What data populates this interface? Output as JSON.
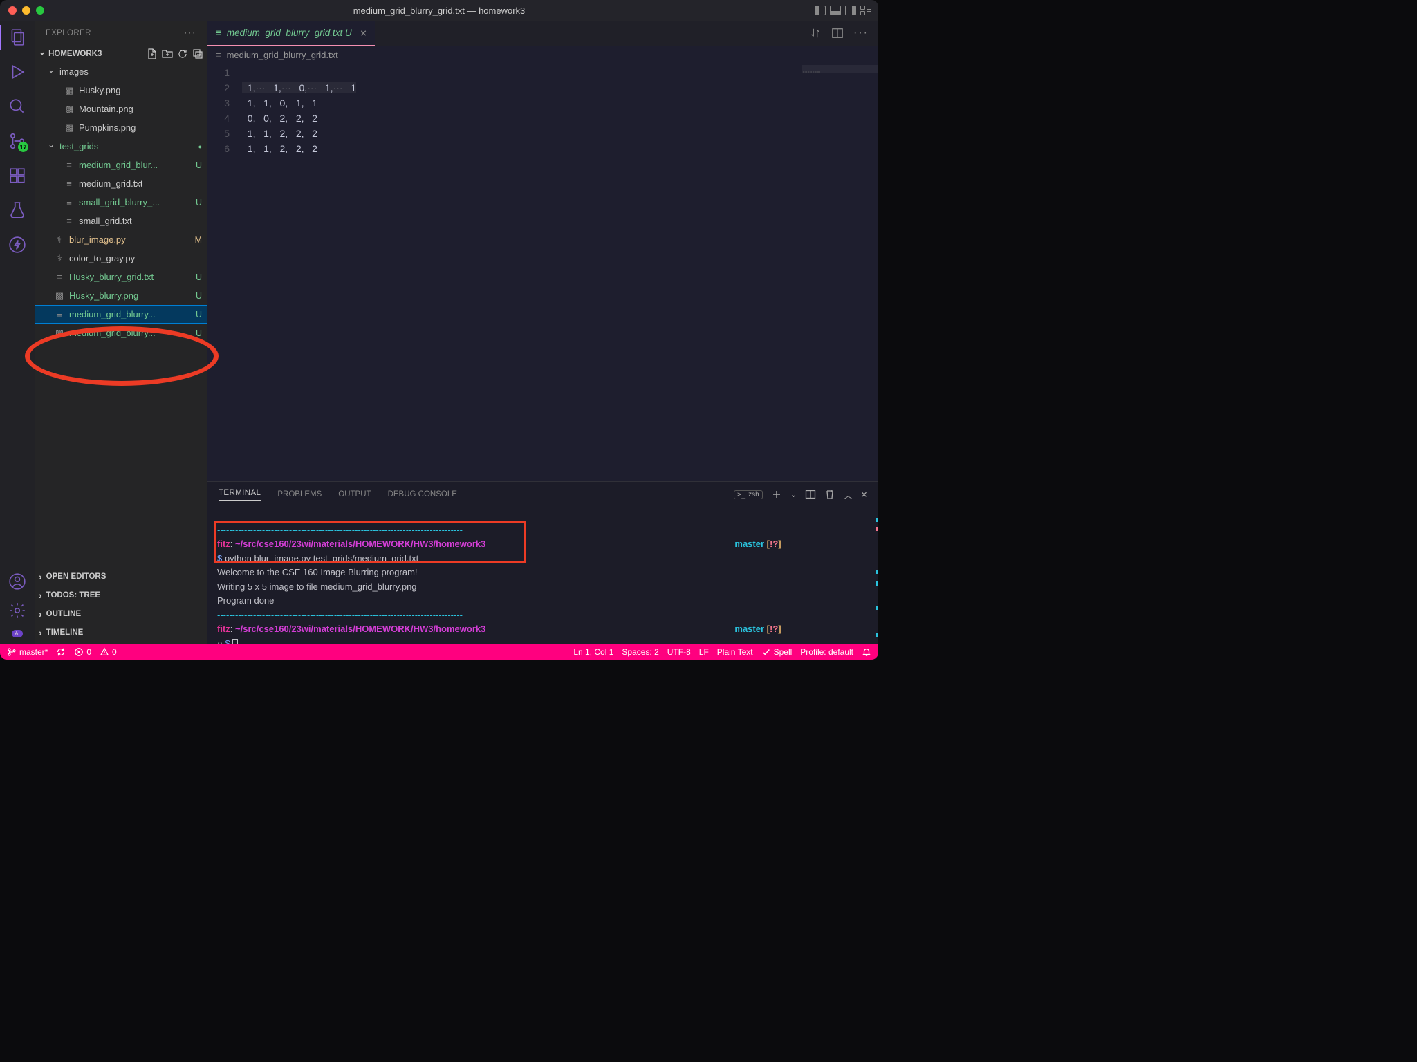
{
  "window_title": "medium_grid_blurry_grid.txt — homework3",
  "explorer": {
    "title": "EXPLORER",
    "section": "HOMEWORK3",
    "scm_badge": "17",
    "folders": {
      "images": {
        "name": "images",
        "items": [
          "Husky.png",
          "Mountain.png",
          "Pumpkins.png"
        ]
      },
      "test_grids": {
        "name": "test_grids",
        "items": [
          {
            "name": "medium_grid_blur...",
            "status": "U"
          },
          {
            "name": "medium_grid.txt",
            "status": ""
          },
          {
            "name": "small_grid_blurry_...",
            "status": "U"
          },
          {
            "name": "small_grid.txt",
            "status": ""
          }
        ]
      }
    },
    "root_files": [
      {
        "name": "blur_image.py",
        "status": "M"
      },
      {
        "name": "color_to_gray.py",
        "status": ""
      },
      {
        "name": "Husky_blurry_grid.txt",
        "status": "U"
      },
      {
        "name": "Husky_blurry.png",
        "status": "U"
      },
      {
        "name": "medium_grid_blurry...",
        "status": "U"
      },
      {
        "name": "medium_grid_blurry...",
        "status": "U"
      }
    ],
    "collapsed": [
      "OPEN EDITORS",
      "TODOS: TREE",
      "OUTLINE",
      "TIMELINE"
    ]
  },
  "editor_tab": {
    "name": "medium_grid_blurry_grid.txt",
    "status": "U",
    "breadcrumb": "medium_grid_blurry_grid.txt"
  },
  "code_lines": [
    "  1,   1,   0,   1,   1",
    "  1,   1,   0,   1,   1",
    "  0,   0,   2,   2,   2",
    "  1,   1,   2,   2,   2",
    "  1,   1,   2,   2,   2",
    ""
  ],
  "code_line1_parts": [
    "  1,",
    "   1,",
    "   0,",
    "   1,",
    "   1"
  ],
  "panel": {
    "tabs": [
      "TERMINAL",
      "PROBLEMS",
      "OUTPUT",
      "DEBUG CONSOLE"
    ],
    "shell": "zsh"
  },
  "terminal": {
    "dashline": "----------------------------------------------------------------------------------",
    "user": "fitz",
    "sep": ": ",
    "path": "~/src/cse160/23wi/materials/HOMEWORK/HW3/homework3",
    "branch_lbl": "master ",
    "branch_stat": "[!?]",
    "cmd_prompt": "$ ",
    "cmd": "python blur_image.py test_grids/medium_grid.txt",
    "out1": "Welcome to the CSE 160 Image Blurring program!",
    "out2": "Writing 5 x 5 image to file medium_grid_blurry.png",
    "out3": "Program done",
    "circle": "○ "
  },
  "status": {
    "branch": "master*",
    "errors": "0",
    "warnings": "0",
    "cursor": "Ln 1, Col 1",
    "spaces": "Spaces: 2",
    "encoding": "UTF-8",
    "eol": "LF",
    "lang": "Plain Text",
    "spell": "Spell",
    "profile": "Profile: default"
  }
}
